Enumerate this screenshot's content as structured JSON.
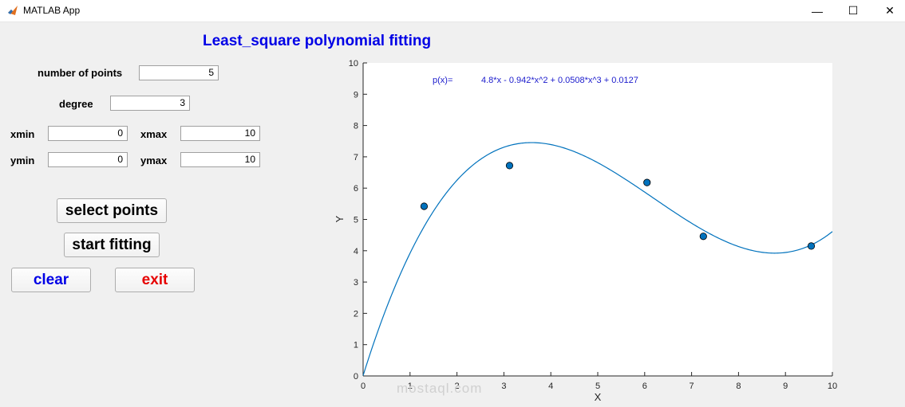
{
  "window": {
    "title": "MATLAB App",
    "minimize_glyph": "—",
    "maximize_glyph": "☐",
    "close_glyph": "✕"
  },
  "app": {
    "title": "Least_square polynomial fitting",
    "fields": {
      "num_points": {
        "label": "number of points",
        "value": "5"
      },
      "degree": {
        "label": "degree",
        "value": "3"
      },
      "xmin": {
        "label": "xmin",
        "value": "0"
      },
      "xmax": {
        "label": "xmax",
        "value": "10"
      },
      "ymin": {
        "label": "ymin",
        "value": "0"
      },
      "ymax": {
        "label": "ymax",
        "value": "10"
      }
    },
    "buttons": {
      "select": "select points",
      "start": "start fitting",
      "clear": "clear",
      "exit": "exit"
    },
    "colors": {
      "title": "#0000e6",
      "clear": "#0000e6",
      "exit": "#e60000",
      "curve": "#0072bd",
      "points": "#0072bd"
    }
  },
  "watermark": "mostaql.com",
  "chart_data": {
    "type": "scatter",
    "xlabel": "X",
    "ylabel": "Y",
    "xlim": [
      0,
      10
    ],
    "ylim": [
      0,
      10
    ],
    "xticks": [
      0,
      1,
      2,
      3,
      4,
      5,
      6,
      7,
      8,
      9,
      10
    ],
    "yticks": [
      0,
      1,
      2,
      3,
      4,
      5,
      6,
      7,
      8,
      9,
      10
    ],
    "grid": false,
    "points": [
      {
        "x": 1.3,
        "y": 5.42
      },
      {
        "x": 3.12,
        "y": 6.72
      },
      {
        "x": 6.05,
        "y": 6.18
      },
      {
        "x": 7.25,
        "y": 4.46
      },
      {
        "x": 9.55,
        "y": 4.15
      }
    ],
    "equation": {
      "prefix": "p(x)=",
      "text": "4.8*x - 0.942*x^2 + 0.0508*x^3 + 0.0127"
    },
    "coefficients": [
      0.0127,
      4.8,
      -0.942,
      0.0508
    ]
  }
}
